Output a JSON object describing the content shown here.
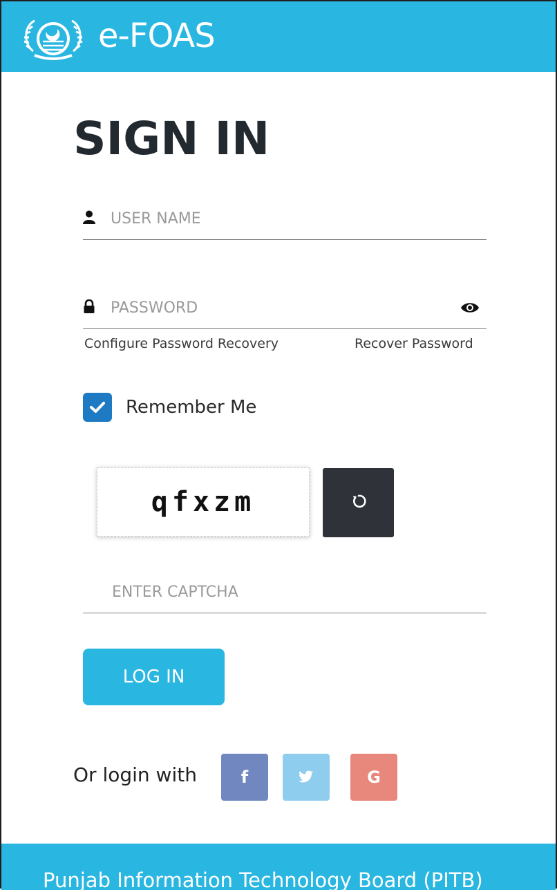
{
  "header": {
    "title": "e-FOAS",
    "logo_icon": "punjab-emblem-icon"
  },
  "page": {
    "title": "SIGN IN"
  },
  "username": {
    "placeholder": "USER NAME",
    "value": "",
    "icon": "user-icon"
  },
  "password": {
    "placeholder": "PASSWORD",
    "value": "",
    "icon": "lock-icon",
    "toggle_icon": "eye-icon"
  },
  "links": {
    "configure": "Configure Password Recovery",
    "recover": "Recover Password"
  },
  "remember": {
    "label": "Remember Me",
    "checked": true
  },
  "captcha": {
    "text": "qfxzm",
    "placeholder": "ENTER CAPTCHA",
    "value": "",
    "refresh_icon": "refresh-icon"
  },
  "login": {
    "label": "LOG IN"
  },
  "social": {
    "label": "Or login with",
    "facebook": {
      "text": "f",
      "color": "#7187c0"
    },
    "twitter": {
      "icon": "twitter-icon",
      "color": "#8fcdef"
    },
    "google": {
      "text": "G",
      "color": "#e8877c"
    }
  },
  "footer": {
    "text": "Punjab Information Technology Board (PITB)"
  },
  "colors": {
    "accent": "#29b6e0",
    "checkbox": "#1e7ac2",
    "dark": "#2f3238"
  }
}
